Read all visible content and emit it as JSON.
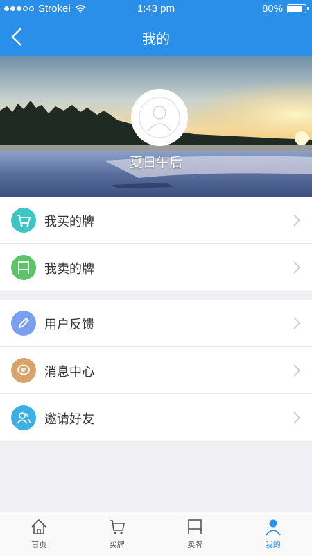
{
  "status": {
    "carrier": "Strokei",
    "time": "1:43 pm",
    "battery": "80%",
    "battery_level": 0.8
  },
  "nav": {
    "title": "我的"
  },
  "profile": {
    "username": "夏日午后"
  },
  "menu_group1": [
    {
      "label": "我买的牌",
      "icon": "cart-icon",
      "color": "#3fc4c4"
    },
    {
      "label": "我卖的牌",
      "icon": "board-icon",
      "color": "#5cc468"
    }
  ],
  "menu_group2": [
    {
      "label": "用户反馈",
      "icon": "pencil-icon",
      "color": "#7b9ff0"
    },
    {
      "label": "消息中心",
      "icon": "message-icon",
      "color": "#d7a36a"
    },
    {
      "label": "邀请好友",
      "icon": "users-icon",
      "color": "#3bb0e3"
    }
  ],
  "tabs": [
    {
      "label": "首页",
      "icon": "home-icon"
    },
    {
      "label": "买牌",
      "icon": "cart-icon"
    },
    {
      "label": "卖牌",
      "icon": "board-icon"
    },
    {
      "label": "我的",
      "icon": "person-icon",
      "active": true
    }
  ],
  "colors": {
    "primary": "#2a8fe8",
    "background": "#efeff4"
  }
}
